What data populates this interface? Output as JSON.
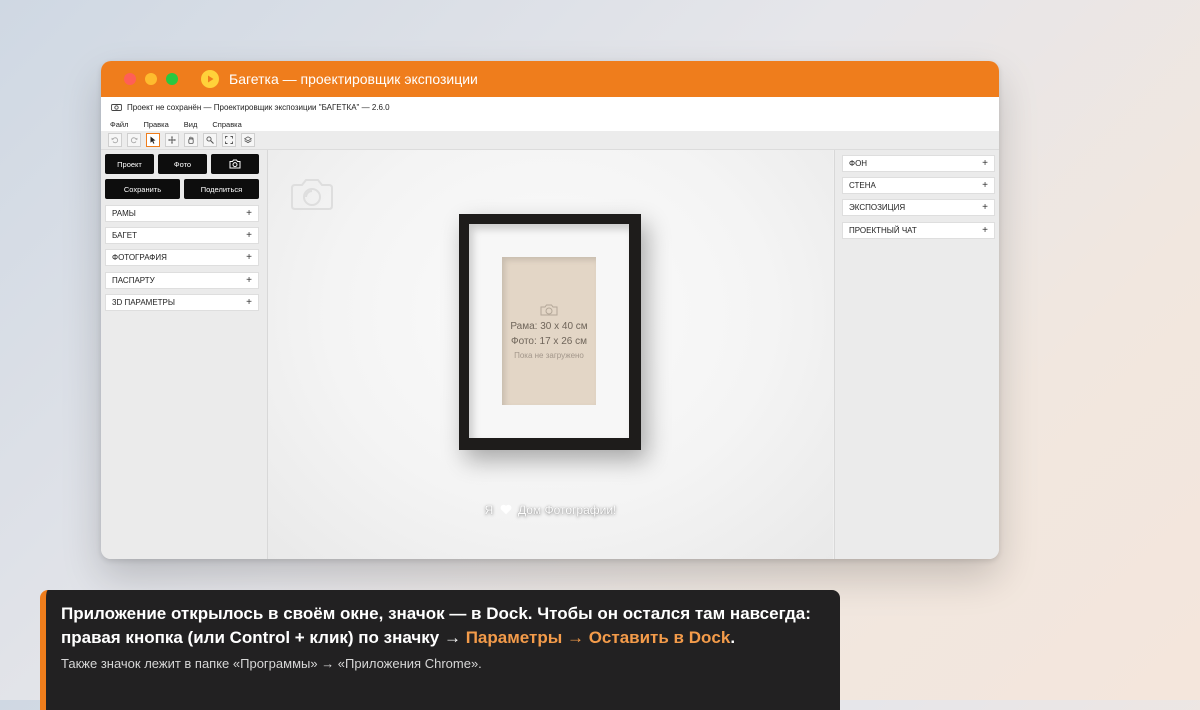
{
  "window": {
    "title": "Багетка — проектировщик экспозиции",
    "info_line": "Проект не сохранён — Проектировщик экспозиции \"БАГЕТКА\"  — 2.6.0"
  },
  "menu": [
    "Файл",
    "Правка",
    "Вид",
    "Справка"
  ],
  "toolbar": {
    "tools": [
      "undo-icon",
      "redo-icon",
      "pointer-icon",
      "move-icon",
      "hand-icon",
      "zoom-icon",
      "fullscreen-icon",
      "layers-icon"
    ],
    "active_tool": "pointer-icon"
  },
  "left_panel": {
    "buttons_row1": [
      "Проект",
      "Фото"
    ],
    "camera_button_icon": "camera-icon",
    "buttons_row2": [
      "Сохранить",
      "Поделиться"
    ],
    "sections": [
      "РАМЫ",
      "БАГЕТ",
      "ФОТОГРАФИЯ",
      "ПАСПАРТУ",
      "3D ПАРАМЕТРЫ"
    ],
    "expand_symbol": "+"
  },
  "canvas": {
    "frame_label": "Рама: 30 х 40 см",
    "photo_label": "Фото: 17 х 26 см",
    "status_label": "Пока не загружено",
    "love_text_prefix": "Я",
    "love_text_suffix": "Дом Фотографии!"
  },
  "right_panel": {
    "sections": [
      "ФОН",
      "СТЕНА",
      "ЭКСПОЗИЦИЯ",
      "ПРОЕКТНЫЙ ЧАТ"
    ],
    "expand_symbol": "+"
  },
  "tip": {
    "text_before": "Приложение открылось в своём окне, значок — в Dock. Чтобы он остался там навсегда: правая кнопка (или Control + клик) по значку → ",
    "highlight": "Параметры → Оставить в Dock",
    "text_after": ".",
    "sub": "Также значок лежит в папке «Программы» → «Приложения Chrome».",
    "accent_color": "#ef7d1c"
  },
  "colors": {
    "titlebar": "#ef7d1c",
    "highlight": "#f39b4a"
  }
}
